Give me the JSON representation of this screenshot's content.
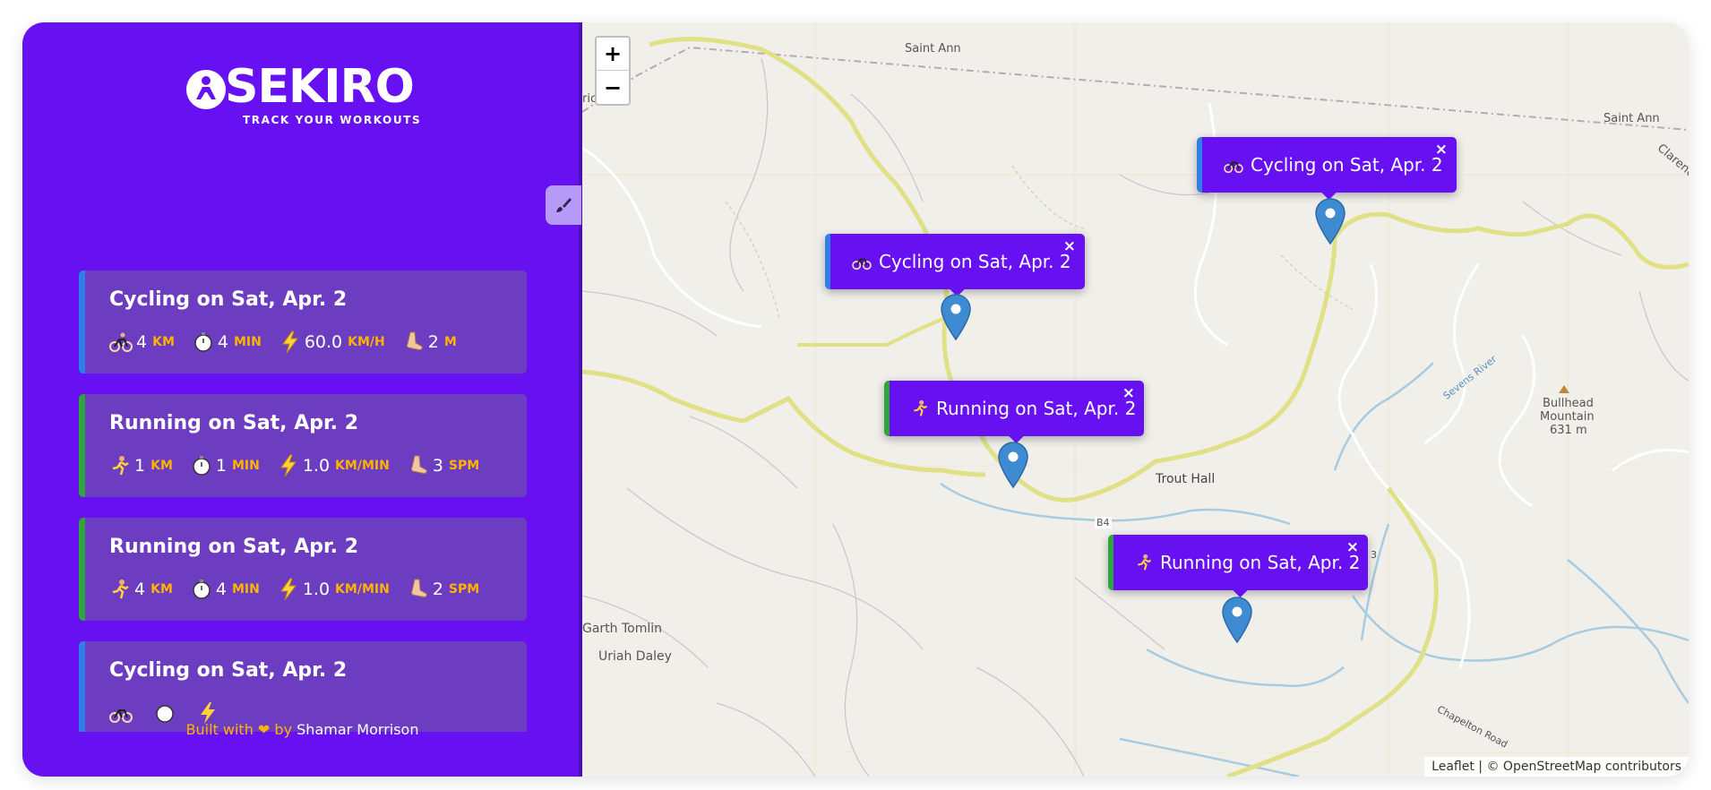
{
  "app": {
    "logo_text": "SEKIRO",
    "logo_tagline": "TRACK YOUR WORKOUTS"
  },
  "workouts": [
    {
      "type": "cycling",
      "title": "Cycling on Sat, Apr. 2",
      "distance": "4",
      "distance_unit": "KM",
      "duration": "4",
      "duration_unit": "MIN",
      "speed": "60.0",
      "speed_unit": "KM/H",
      "extra": "2",
      "extra_unit": "M"
    },
    {
      "type": "running",
      "title": "Running on Sat, Apr. 2",
      "distance": "1",
      "distance_unit": "KM",
      "duration": "1",
      "duration_unit": "MIN",
      "speed": "1.0",
      "speed_unit": "KM/MIN",
      "extra": "3",
      "extra_unit": "SPM"
    },
    {
      "type": "running",
      "title": "Running on Sat, Apr. 2",
      "distance": "4",
      "distance_unit": "KM",
      "duration": "4",
      "duration_unit": "MIN",
      "speed": "1.0",
      "speed_unit": "KM/MIN",
      "extra": "2",
      "extra_unit": "SPM"
    },
    {
      "type": "cycling",
      "title": "Cycling on Sat, Apr. 2"
    }
  ],
  "footer": {
    "prefix": "Built with",
    "heart": "❤",
    "by": "by",
    "author": "Shamar Morrison"
  },
  "map": {
    "zoom_in": "+",
    "zoom_out": "−",
    "popups": [
      {
        "type": "cycling",
        "label": "Cycling on Sat, Apr. 2",
        "close": "×"
      },
      {
        "type": "cycling",
        "label": "Cycling on Sat, Apr. 2",
        "close": "×"
      },
      {
        "type": "running",
        "label": "Running on Sat, Apr. 2",
        "close": "×"
      },
      {
        "type": "running",
        "label": "Running on Sat, Apr. 2",
        "close": "×"
      }
    ],
    "place_labels": {
      "saint_ann_1": "Saint Ann",
      "saint_ann_2": "Saint Ann",
      "clarendon": "Clarendo",
      "trout_hall": "Trout Hall",
      "bullhead_1": "Bullhead",
      "bullhead_2": "Mountain",
      "bullhead_3": "631 m",
      "garth": "Garth Tomlin",
      "uriah": "Uriah Daley",
      "road_b4": "B4",
      "road_b3": "3",
      "river": "Sevens River",
      "road_chapelton": "Chapelton Road",
      "edge": "ric"
    },
    "attribution": {
      "leaflet": "Leaflet",
      "sep": "| ©",
      "osm": "OpenStreetMap",
      "contributors": "contributors"
    }
  },
  "colors": {
    "sidebar": "#6711f2",
    "card": "#6c3dc0",
    "accent_unit": "#ffb300",
    "cycling_border": "#2f7fe8",
    "running_border": "#2fa63a",
    "marker": "#3e8bd2"
  }
}
